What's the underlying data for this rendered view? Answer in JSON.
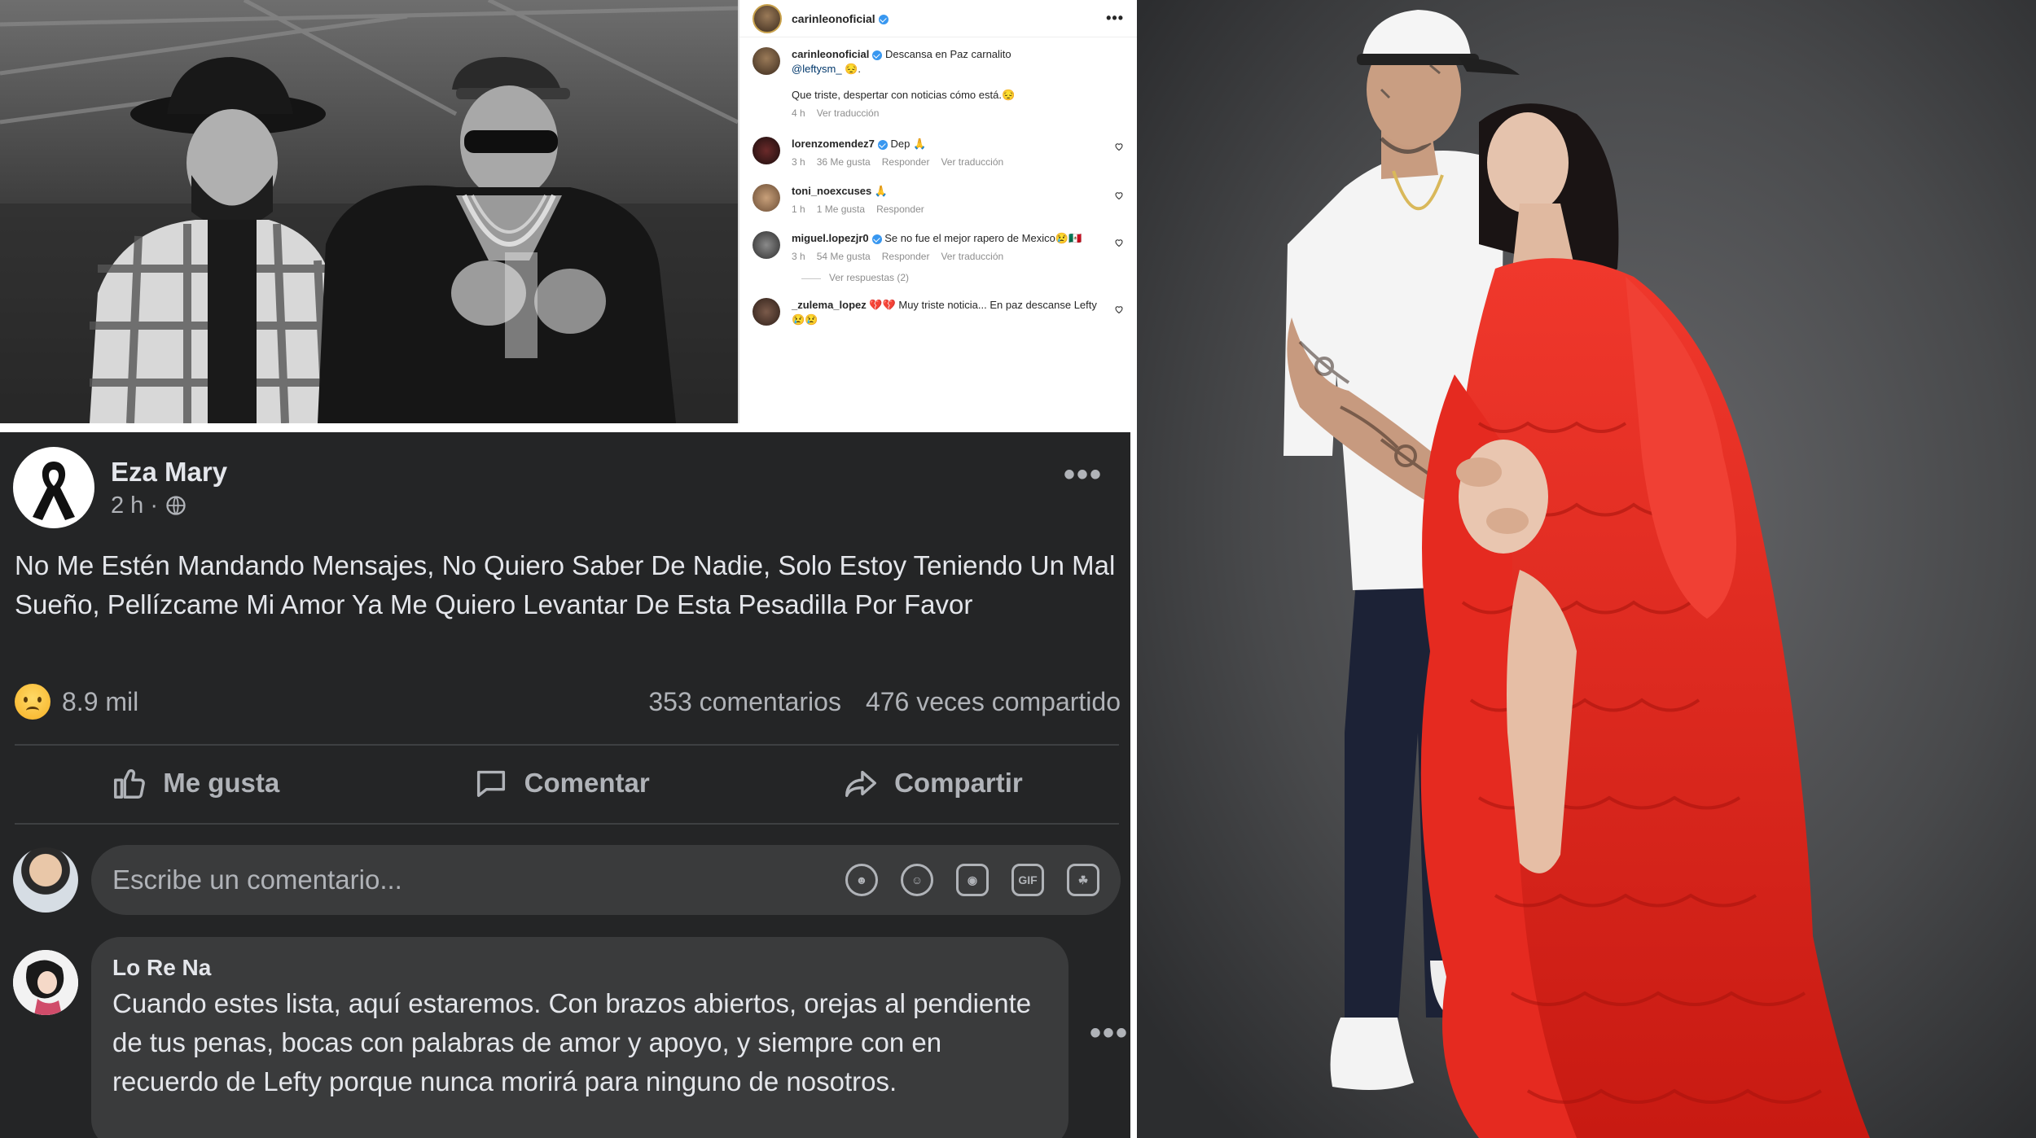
{
  "instagram": {
    "account": "carinleonoficial",
    "more_icon": "•••",
    "caption": {
      "user": "carinleonoficial",
      "text_1": "Descansa en Paz carnalito",
      "mention": "@leftysm_",
      "emoji_1": "😔.",
      "text_2": "Que triste, despertar con noticias cómo está.😔",
      "time": "4 h",
      "translate": "Ver traducción"
    },
    "comments": [
      {
        "user": "lorenzomendez7",
        "verified": true,
        "text": "Dep 🙏",
        "time": "3 h",
        "likes": "36 Me gusta",
        "reply": "Responder",
        "translate": "Ver traducción"
      },
      {
        "user": "toni_noexcuses",
        "verified": false,
        "text": "🙏",
        "time": "1 h",
        "likes": "1 Me gusta",
        "reply": "Responder",
        "translate": ""
      },
      {
        "user": "miguel.lopezjr0",
        "verified": true,
        "text": "Se no fue el mejor rapero de Mexico😢🇲🇽",
        "time": "3 h",
        "likes": "54 Me gusta",
        "reply": "Responder",
        "translate": "Ver traducción"
      },
      {
        "user": "_zulema_lopez",
        "verified": false,
        "text": "💔💔 Muy triste noticia... En paz descanse Lefty😢😢",
        "time": "",
        "likes": "",
        "reply": "",
        "translate": ""
      }
    ],
    "view_replies": "Ver respuestas (2)"
  },
  "facebook": {
    "author": "Eza Mary",
    "time": "2 h ·",
    "more_icon": "•••",
    "post_text": "No Me Estén Mandando Mensajes, No Quiero Saber De Nadie, Solo Estoy Teniendo Un Mal Sueño, Pellízcame Mi Amor Ya Me Quiero Levantar De Esta Pesadilla Por Favor",
    "reactions": "8.9 mil",
    "comments_count": "353 comentarios",
    "shares_count": "476 veces compartido",
    "actions": {
      "like": "Me gusta",
      "comment": "Comentar",
      "share": "Compartir"
    },
    "comment_placeholder": "Escribe un comentario...",
    "reply": {
      "name": "Lo Re Na",
      "text": "Cuando estes lista, aquí estaremos. Con brazos abiertos, orejas al pendiente de tus penas, bocas con palabras de amor y apoyo, y siempre con en recuerdo de Lefty porque nunca morirá para ninguno de nosotros.",
      "more_icon": "•••"
    }
  },
  "colors": {
    "fb_bg": "#242526",
    "fb_text": "#e4e6eb",
    "fb_muted": "#b0b3b8",
    "ig_blue": "#3897f0",
    "dress_red": "#e0241b"
  },
  "icons": [
    "verified-badge-icon",
    "heart-outline-icon",
    "globe-icon",
    "sad-reaction-icon",
    "like-thumb-icon",
    "comment-bubble-icon",
    "share-arrow-icon",
    "sticker-avatar-icon",
    "emoji-icon",
    "camera-icon",
    "gif-icon",
    "sticker-icon",
    "black-ribbon-icon"
  ]
}
